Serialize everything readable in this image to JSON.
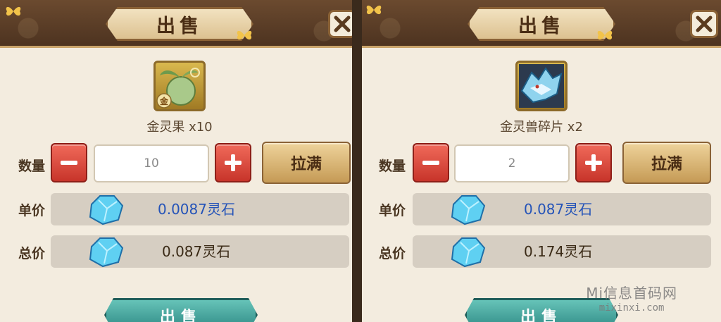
{
  "panels": [
    {
      "title": "出售",
      "item_name": "金灵果 x10",
      "quantity_label": "数量",
      "quantity_value": "10",
      "fill_label": "拉满",
      "unit_price_label": "单价",
      "unit_price": "0.0087灵石",
      "total_price_label": "总价",
      "total_price": "0.087灵石",
      "sell_label": "出售",
      "item_icon": "golden-spirit-fruit-icon",
      "item_badge": "金"
    },
    {
      "title": "出售",
      "item_name": "金灵兽碎片 x2",
      "quantity_label": "数量",
      "quantity_value": "2",
      "fill_label": "拉满",
      "unit_price_label": "单价",
      "unit_price": "0.087灵石",
      "total_price_label": "总价",
      "total_price": "0.174灵石",
      "sell_label": "出售",
      "item_icon": "golden-spirit-beast-fragment-icon"
    }
  ],
  "watermark": {
    "title": "Mi信息首码网",
    "url": "mixinxi.com"
  },
  "colors": {
    "unit_price_text": "#2453b8",
    "total_price_text": "#3a2a16",
    "stepper_red": "#d8453a",
    "sell_teal": "#3f9e98",
    "panel_bg": "#f3ecdf"
  }
}
